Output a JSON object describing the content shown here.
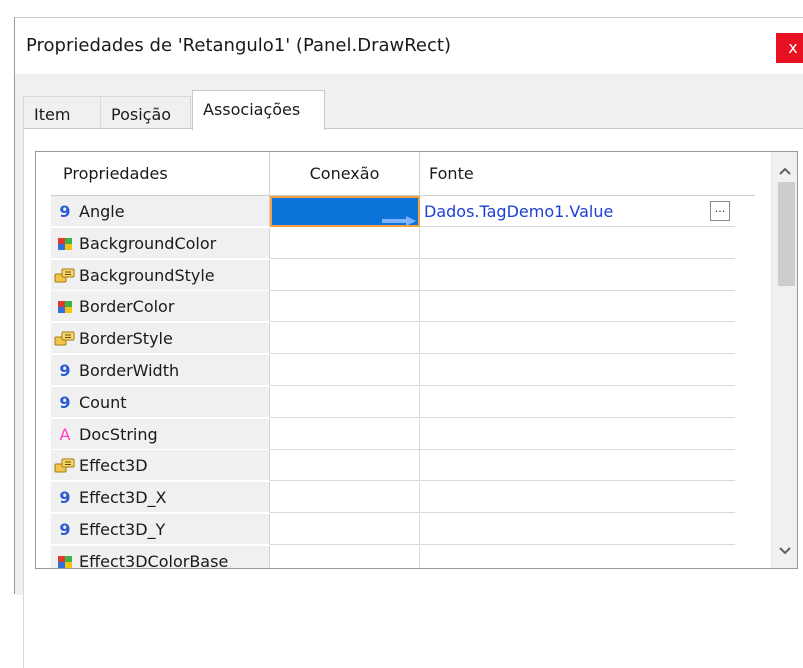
{
  "window": {
    "title": "Propriedades de 'Retangulo1' (Panel.DrawRect)",
    "close_glyph": "x"
  },
  "tabs": [
    {
      "label": "Item",
      "active": false
    },
    {
      "label": "Posição",
      "active": false
    },
    {
      "label": "Associações",
      "active": true
    }
  ],
  "grid": {
    "columns": [
      "Propriedades",
      "Conexão",
      "Fonte"
    ],
    "rows": [
      {
        "icon": "number-icon",
        "icon_glyph": "9",
        "name": "Angle",
        "connection": "link-arrow",
        "source": "Dados.TagDemo1.Value",
        "selected": true
      },
      {
        "icon": "color-icon",
        "icon_glyph": "",
        "name": "BackgroundColor",
        "connection": "",
        "source": ""
      },
      {
        "icon": "enum-icon",
        "icon_glyph": "",
        "name": "BackgroundStyle",
        "connection": "",
        "source": ""
      },
      {
        "icon": "color-icon",
        "icon_glyph": "",
        "name": "BorderColor",
        "connection": "",
        "source": ""
      },
      {
        "icon": "enum-icon",
        "icon_glyph": "",
        "name": "BorderStyle",
        "connection": "",
        "source": ""
      },
      {
        "icon": "number-icon",
        "icon_glyph": "9",
        "name": "BorderWidth",
        "connection": "",
        "source": ""
      },
      {
        "icon": "number-icon",
        "icon_glyph": "9",
        "name": "Count",
        "connection": "",
        "source": ""
      },
      {
        "icon": "text-icon",
        "icon_glyph": "A",
        "name": "DocString",
        "connection": "",
        "source": ""
      },
      {
        "icon": "enum-icon",
        "icon_glyph": "",
        "name": "Effect3D",
        "connection": "",
        "source": ""
      },
      {
        "icon": "number-icon",
        "icon_glyph": "9",
        "name": "Effect3D_X",
        "connection": "",
        "source": ""
      },
      {
        "icon": "number-icon",
        "icon_glyph": "9",
        "name": "Effect3D_Y",
        "connection": "",
        "source": ""
      },
      {
        "icon": "color-icon",
        "icon_glyph": "",
        "name": "Effect3DColorBase",
        "connection": "",
        "source": ""
      }
    ],
    "ellipsis_label": "...",
    "scroll_up_glyph": "^",
    "scroll_down_glyph": "v"
  },
  "colors": {
    "selection_blue": "#0c74d8",
    "focus_border": "#f2a040",
    "source_text": "#1d3fd6",
    "close_red": "#e81123"
  }
}
